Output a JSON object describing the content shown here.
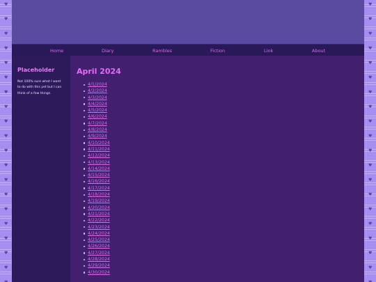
{
  "nav": {
    "items": [
      "Home",
      "Diary",
      "Rambles",
      "Fiction",
      "Link",
      "About"
    ]
  },
  "sidebar": {
    "title": "Placeholder",
    "text": "Not 100% sure what I want to do with this yet but I can think of a few things."
  },
  "main": {
    "title": "April 2024",
    "posts": [
      "4/1/2024",
      "4/2/2024",
      "4/3/2024",
      "4/4/2024",
      "4/5/2024",
      "4/6/2024",
      "4/7/2024",
      "4/8/2024",
      "4/9/2024",
      "4/10/2024",
      "4/11/2024",
      "4/12/2024",
      "4/13/2024",
      "4/14/2024",
      "4/15/2024",
      "4/16/2024",
      "4/17/2024",
      "4/18/2024",
      "4/19/2024",
      "4/20/2024",
      "4/21/2024",
      "4/22/2024",
      "4/23/2024",
      "4/24/2024",
      "4/25/2024",
      "4/26/2024",
      "4/27/2024",
      "4/28/2024",
      "4/29/2024",
      "4/30/2024"
    ]
  },
  "colors": {
    "accent": "#d86ef0",
    "background_pattern": "#a58ef0",
    "header": "#5a4aa0",
    "sidebar": "#2d1a5a",
    "main": "#43206f"
  }
}
